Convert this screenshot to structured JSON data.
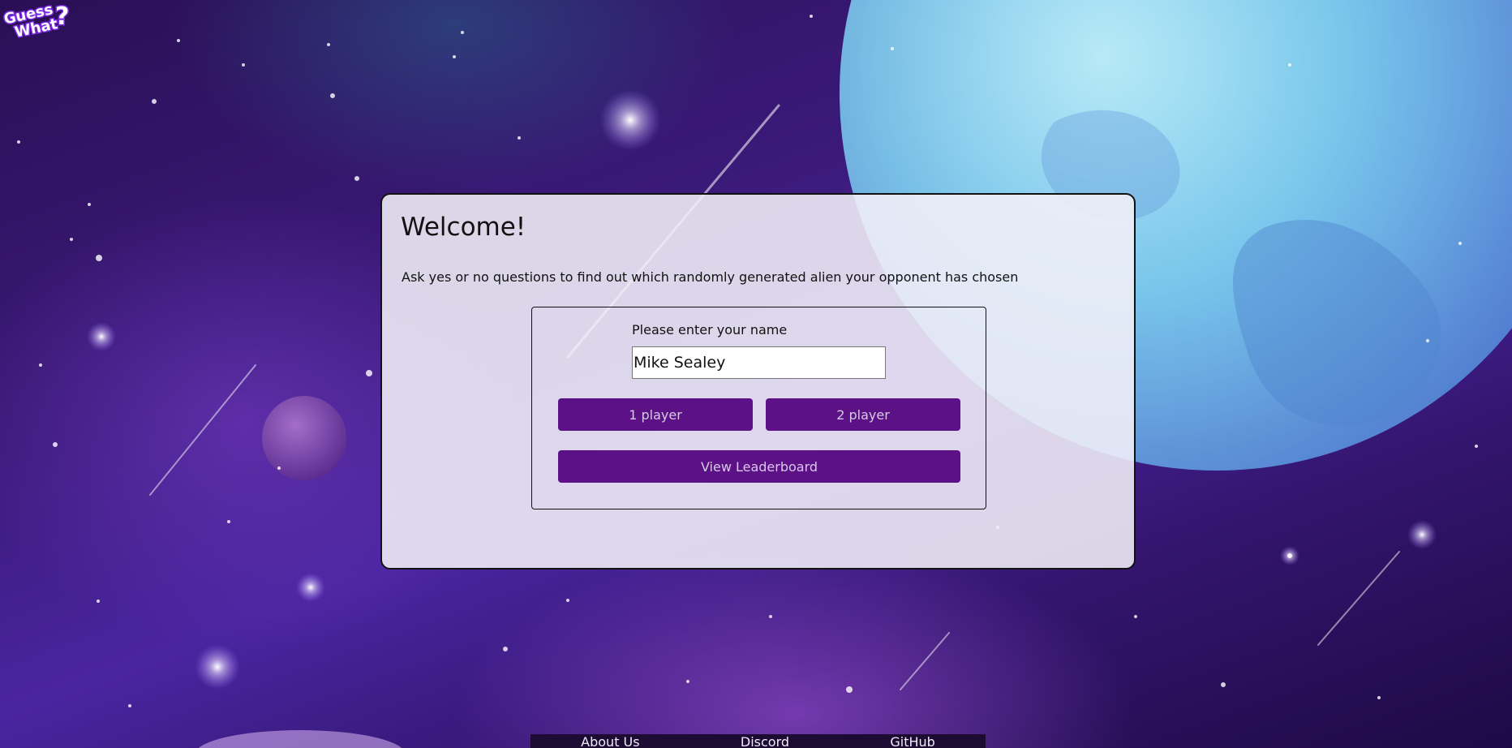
{
  "app": {
    "logo_line1": "Guess",
    "logo_line2": "What",
    "logo_mark": "?"
  },
  "welcome": {
    "title": "Welcome!",
    "subtitle": "Ask yes or no questions to find out which randomly generated alien your opponent has chosen"
  },
  "form": {
    "name_label": "Please enter your name",
    "name_value": "Mike Sealey",
    "one_player_label": "1 player",
    "two_player_label": "2 player",
    "leaderboard_label": "View Leaderboard"
  },
  "footer": {
    "links": [
      "About Us",
      "Discord",
      "GitHub"
    ]
  },
  "colors": {
    "button_bg": "#5c1187",
    "button_text": "#d8c9e8",
    "panel_bg": "#f3f0f8",
    "footer_bg": "#1c0c33"
  },
  "icons": {
    "logo": "guess-what-logo"
  }
}
